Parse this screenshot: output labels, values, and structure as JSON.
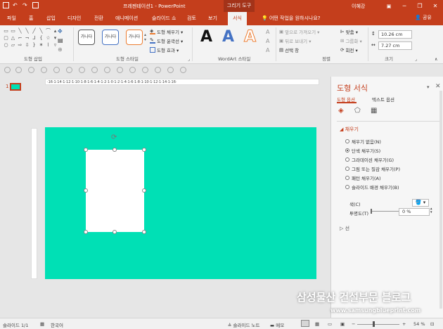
{
  "titlebar": {
    "title": "프레젠테이션1 - PowerPoint",
    "context_tab": "그리기 도구",
    "user": "이혜강",
    "min": "─",
    "restore": "❐",
    "close": "✕"
  },
  "tabs": [
    "파일",
    "홈",
    "삽입",
    "디자인",
    "전환",
    "애니메이션",
    "슬라이드 쇼",
    "검토",
    "보기"
  ],
  "active_tab": "서식",
  "tellme": "💡 어떤 작업을 원하시나요?",
  "share": "👤 공유",
  "ribbon": {
    "groups": {
      "insert_shapes": "도형 삽입",
      "shape_styles": "도형 스타일",
      "wordart": "WordArt 스타일",
      "arrange": "정렬",
      "size": "크기"
    },
    "style_sample": "가나다",
    "shape_fill": "도형 채우기 ▾",
    "shape_outline": "도형 윤곽선 ▾",
    "shape_effects": "도형 효과 ▾",
    "wordart_letter": "A",
    "bring_forward": "앞으로 가져오기 ▾",
    "send_backward": "뒤로 보내기 ▾",
    "selection_pane": "선택 창",
    "align": "맞춤 ▾",
    "group": "그룹화 ▾",
    "rotate": "회전 ▾",
    "height": "10.26 cm",
    "width": "7.27 cm"
  },
  "slide_number": "1",
  "ruler_text": "·16·1·14·1·12·1·10·1·8·1·6·1·4·1·2·1·0·1·2·1·4·1·6·1·8·1·10·1·12·1·14·1·16·",
  "slide_color": "#00e0b5",
  "panel": {
    "title": "도형 서식",
    "tab_shape": "도형 옵션",
    "tab_text": "텍스트 옵션",
    "fill_section": "◢ 채우기",
    "options": [
      "채우기 없음(N)",
      "단색 채우기(S)",
      "그라데이션 채우기(G)",
      "그림 또는 질감 채우기(P)",
      "패턴 채우기(A)",
      "슬라이드 배경 채우기(B)"
    ],
    "selected_option": 1,
    "color_label": "색(C)",
    "color_btn": "🪣 ▾",
    "transparency_label": "투명도(T)",
    "transparency_value": "0 %",
    "line_section": "▷ 선"
  },
  "status": {
    "slide": "슬라이드 1/1",
    "lang": "한국어",
    "notes": "≜ 슬라이드 노트",
    "comments": "▬ 메모",
    "zoom": "54 %"
  },
  "watermark": {
    "title": "삼성물산 건설부문 블로그",
    "url": "www.samsungblueprint.com"
  }
}
